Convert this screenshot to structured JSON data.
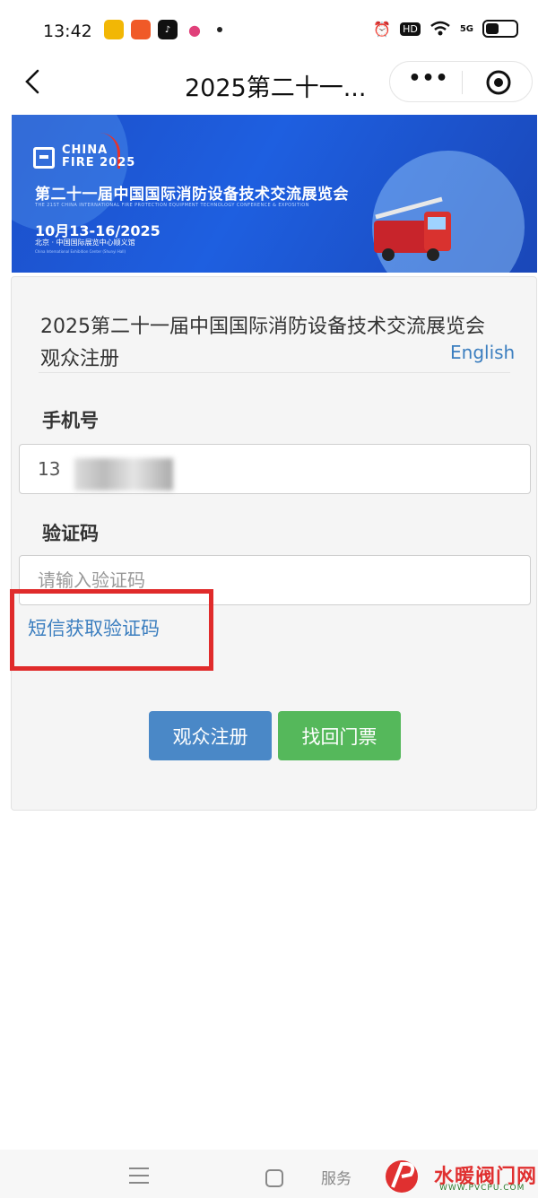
{
  "status_bar": {
    "time": "13:42",
    "app_icons": [
      "app-icon-1",
      "app-icon-2",
      "tiktok-icon",
      "app-icon-4"
    ],
    "right_icons": [
      "alarm-icon",
      "hd-icon",
      "wifi-icon",
      "signal-icon",
      "battery-icon"
    ],
    "hd_label": "HD",
    "network_label": "5G"
  },
  "nav": {
    "title": "2025第二十一...",
    "more_label": "•••"
  },
  "banner": {
    "logo_line1": "CHINA",
    "logo_line2": "FIRE 2025",
    "title": "第二十一届中国国际消防设备技术交流展览会",
    "subtitle": "THE 21ST CHINA INTERNATIONAL FIRE PROTECTION EQUIPMENT TECHNOLOGY CONFERENCE & EXPOSITION",
    "dates": "10月13-16/2025",
    "venue": "北京 · 中国国际展览中心顺义馆",
    "venue_en": "China International Exhibition Center (Shunyi Hall)"
  },
  "form": {
    "title": "2025第二十一届中国国际消防设备技术交流展览会 观众注册",
    "english_link": "English",
    "phone_label": "手机号",
    "phone_value": "13",
    "code_label": "验证码",
    "code_placeholder": "请输入验证码",
    "sms_link": "短信获取验证码",
    "register_button": "观众注册",
    "retrieve_button": "找回门票"
  },
  "bottom_bar": {
    "watermark_chat": "服务",
    "watermark_brand": "水暖阀门网",
    "watermark_url": "WWW.PVCPU.COM"
  },
  "colors": {
    "link": "#3b7ebf",
    "primary_button": "#4a88c7",
    "success_button": "#55b85b",
    "highlight_box": "#e02b2b"
  }
}
